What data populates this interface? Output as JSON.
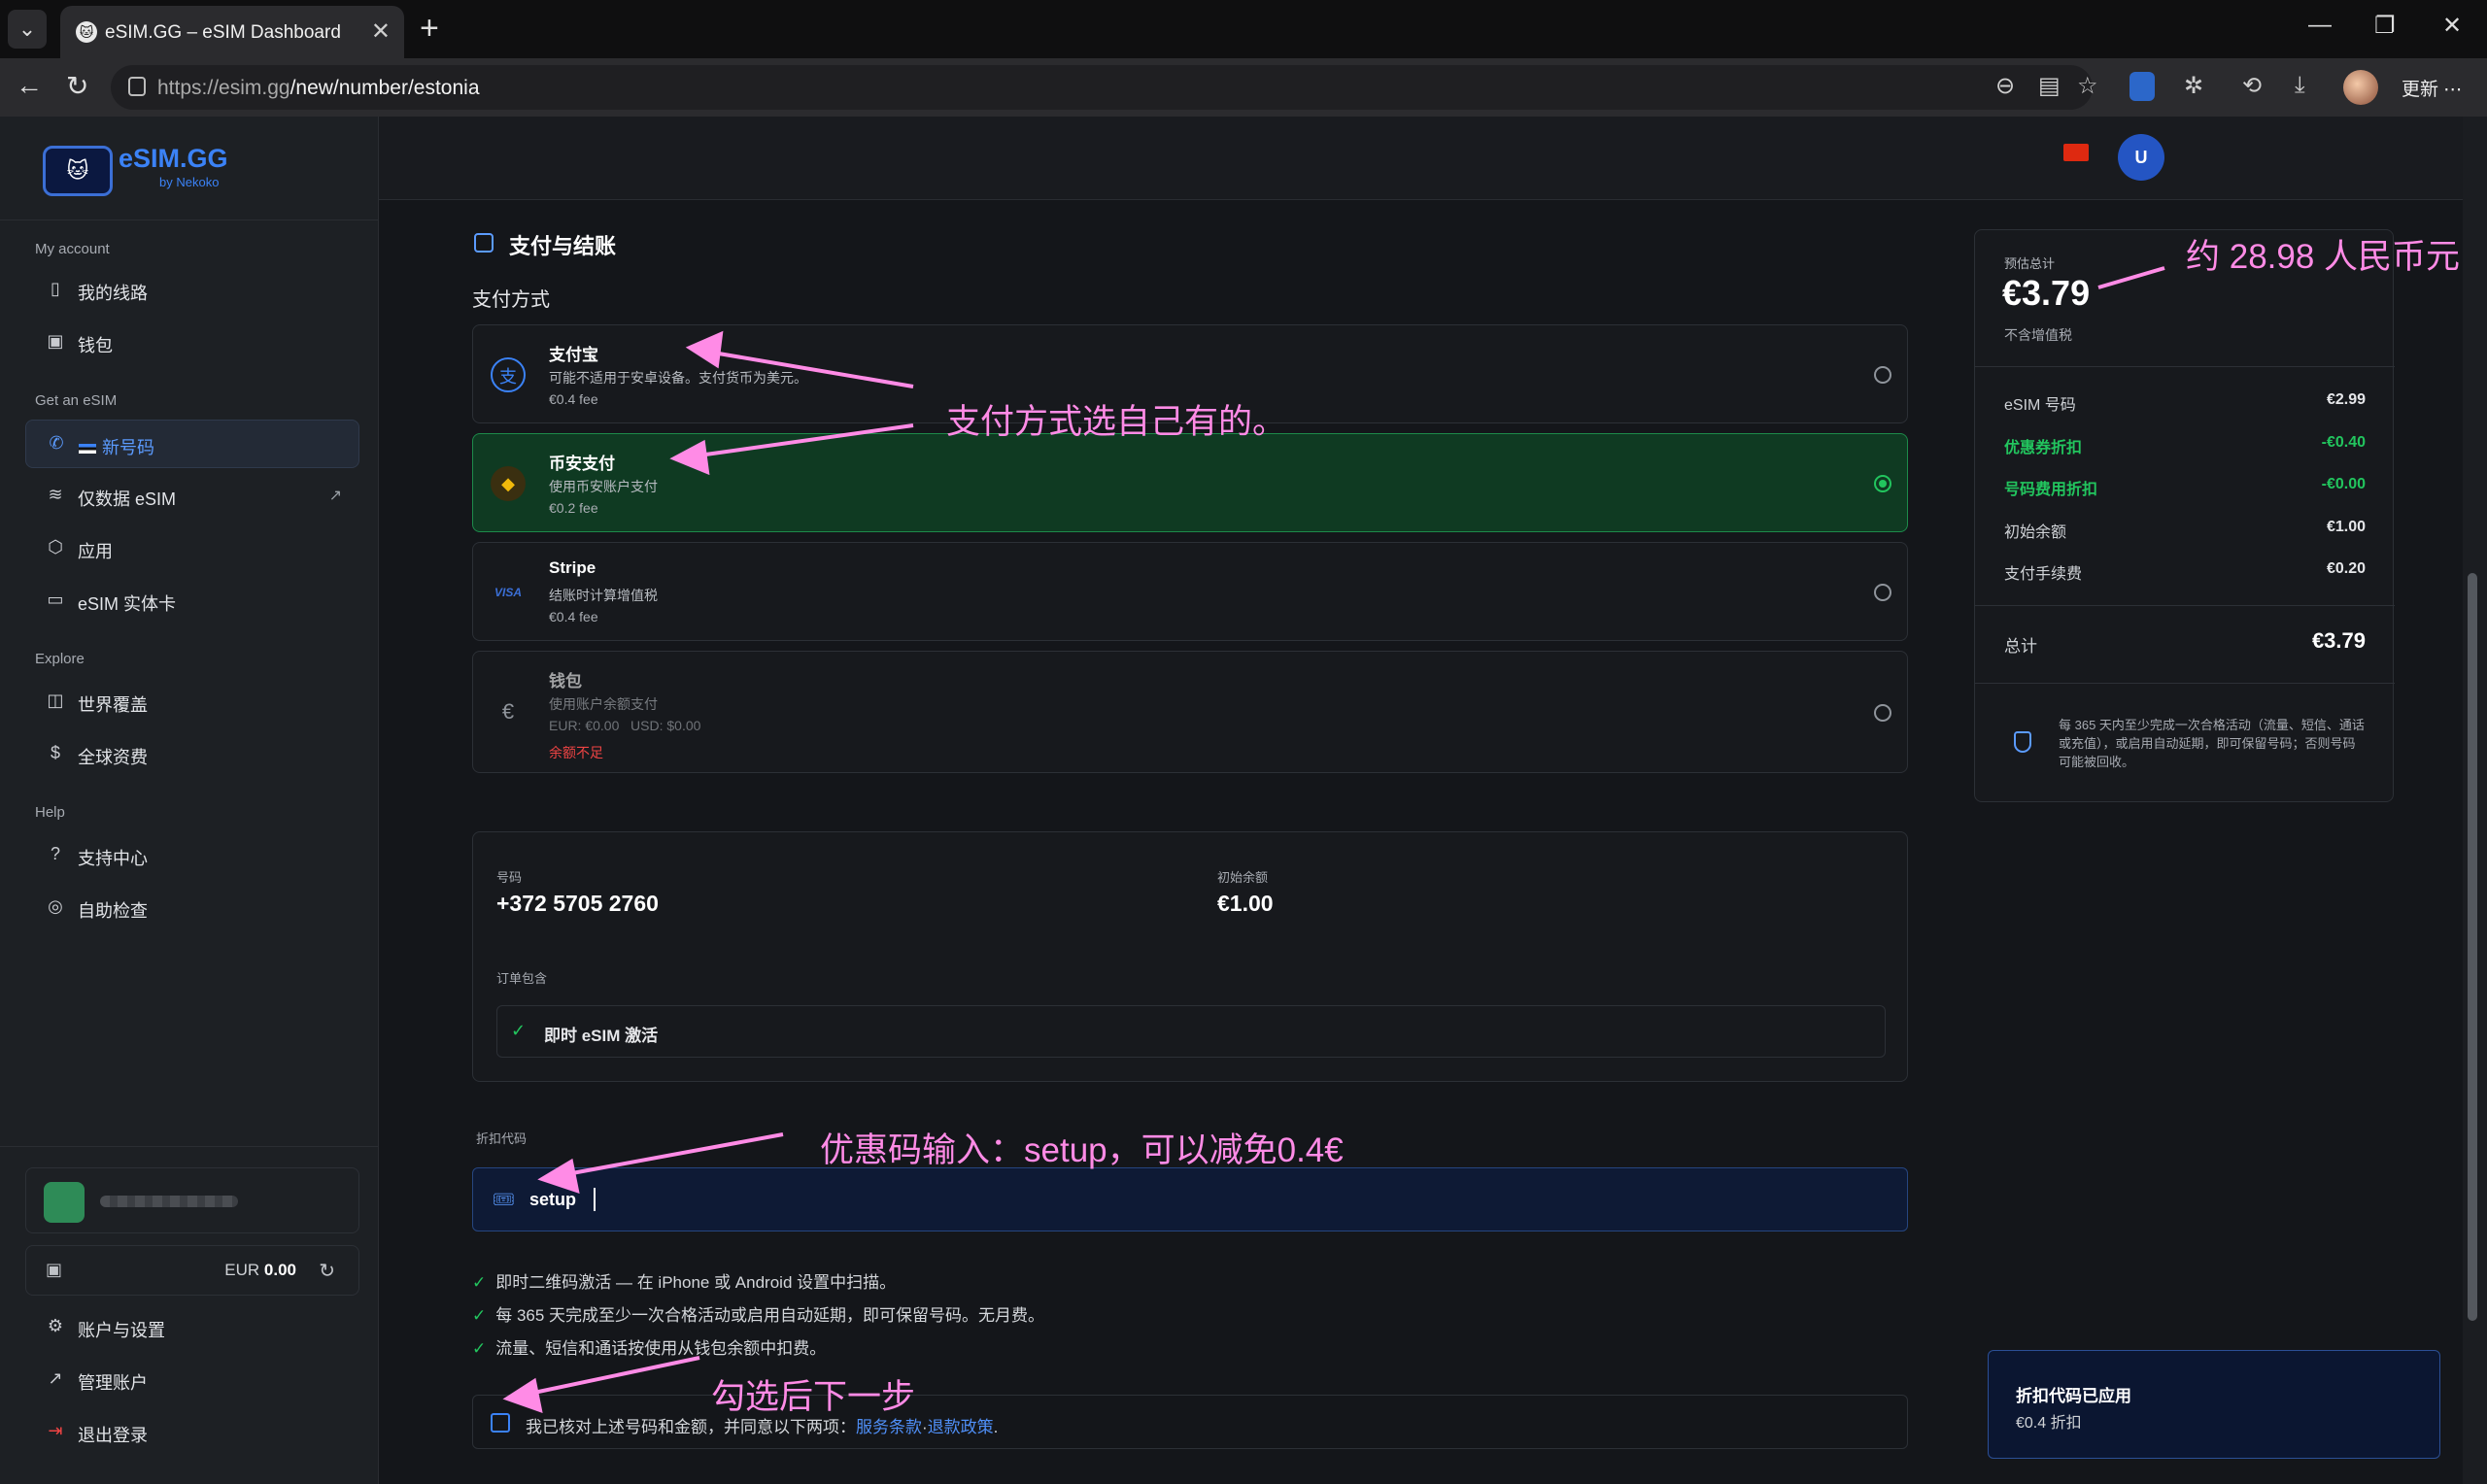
{
  "browser": {
    "tab_title": "eSIM.GG – eSIM Dashboard",
    "url_host": "https://esim.gg",
    "url_path": "/new/number/estonia",
    "update_label": "更新"
  },
  "sidebar": {
    "logo_title": "eSIM.GG",
    "logo_sub": "by Nekoko",
    "group_account": "My account",
    "group_get": "Get an eSIM",
    "group_explore": "Explore",
    "group_help": "Help",
    "items": {
      "my_numbers": "我的线路",
      "wallet": "钱包",
      "new_number": "新号码",
      "data_esim": "仅数据 eSIM",
      "apps": "应用",
      "physical": "eSIM 实体卡",
      "coverage": "世界覆盖",
      "pricing": "全球资费",
      "support": "支持中心",
      "selfcheck": "自助检查",
      "settings": "账户与设置",
      "manage": "管理账户",
      "logout": "退出登录"
    },
    "balance_currency": "EUR",
    "balance_value": "0.00"
  },
  "header": {
    "avatar_letter": "U"
  },
  "checkout": {
    "title": "支付与结账",
    "payment_label": "支付方式",
    "methods": [
      {
        "name": "支付宝",
        "desc": "可能不适用于安卓设备。支付货币为美元。",
        "fee": "€0.4 fee"
      },
      {
        "name": "币安支付",
        "desc": "使用币安账户支付",
        "fee": "€0.2 fee"
      },
      {
        "name": "Stripe",
        "desc": "结账时计算增值税",
        "fee": "€0.4 fee",
        "badge": "VISA"
      },
      {
        "name": "钱包",
        "desc": "使用账户余额支付",
        "fee": "EUR: €0.00   USD: $0.00",
        "warning": "余额不足"
      }
    ],
    "number_label": "号码",
    "number_value": "+372 5705 2760",
    "initial_label": "初始余额",
    "initial_value": "€1.00",
    "included_label": "订单包含",
    "included_item": "即时 eSIM 激活",
    "discount_label": "折扣代码",
    "discount_value": "setup",
    "notes": [
      "即时二维码激活 — 在 iPhone 或 Android 设置中扫描。",
      "每 365 天完成至少一次合格活动或启用自动延期，即可保留号码。无月费。",
      "流量、短信和通话按使用从钱包余额中扣费。"
    ],
    "agree_text": "我已核对上述号码和金额，并同意以下两项：",
    "terms_link": "服务条款",
    "dot": "·",
    "refund_link": "退款政策",
    "period": "."
  },
  "summary": {
    "est_label": "预估总计",
    "total": "€3.79",
    "vat_note": "不含增值税",
    "rows": [
      {
        "k": "eSIM 号码",
        "v": "€2.99"
      },
      {
        "k": "优惠券折扣",
        "v": "-€0.40"
      },
      {
        "k": "号码费用折扣",
        "v": "-€0.00"
      },
      {
        "k": "初始余额",
        "v": "€1.00"
      },
      {
        "k": "支付手续费",
        "v": "€0.20"
      }
    ],
    "final_label": "总计",
    "final_value": "€3.79",
    "note": "每 365 天内至少完成一次合格活动（流量、短信、通话或充值），或启用自动延期，即可保留号码；否则号码可能被回收。"
  },
  "toast": {
    "title": "折扣代码已应用",
    "sub": "€0.4 折扣"
  },
  "annotations": {
    "rmb": "约 28.98 人民币元",
    "payment": "支付方式选自己有的。",
    "coupon": "优惠码输入：setup，可以减免0.4€",
    "next": "勾选后下一步"
  },
  "colors": {
    "accent": "#3b82f6",
    "success": "#22c55e",
    "annotation": "#ff8be6",
    "selected_bg": "#0f3a22"
  }
}
